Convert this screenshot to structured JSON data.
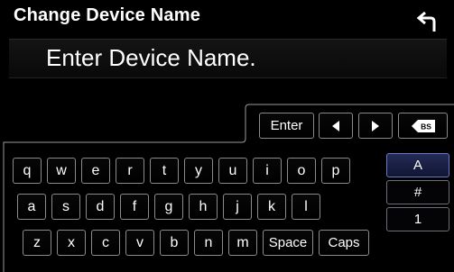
{
  "header": {
    "title": "Change Device Name"
  },
  "entry": {
    "text": "Enter Device Name."
  },
  "toolbar": {
    "enter": "Enter"
  },
  "keyboard": {
    "row1": [
      "q",
      "w",
      "e",
      "r",
      "t",
      "y",
      "u",
      "i",
      "o",
      "p"
    ],
    "row2": [
      "a",
      "s",
      "d",
      "f",
      "g",
      "h",
      "j",
      "k",
      "l"
    ],
    "row3": [
      "z",
      "x",
      "c",
      "v",
      "b",
      "n",
      "m",
      "Space",
      "Caps"
    ]
  },
  "modes": [
    "A",
    "#",
    "1"
  ],
  "colors": {
    "accent": "#2b3368",
    "key_border": "#8a8a8a"
  }
}
